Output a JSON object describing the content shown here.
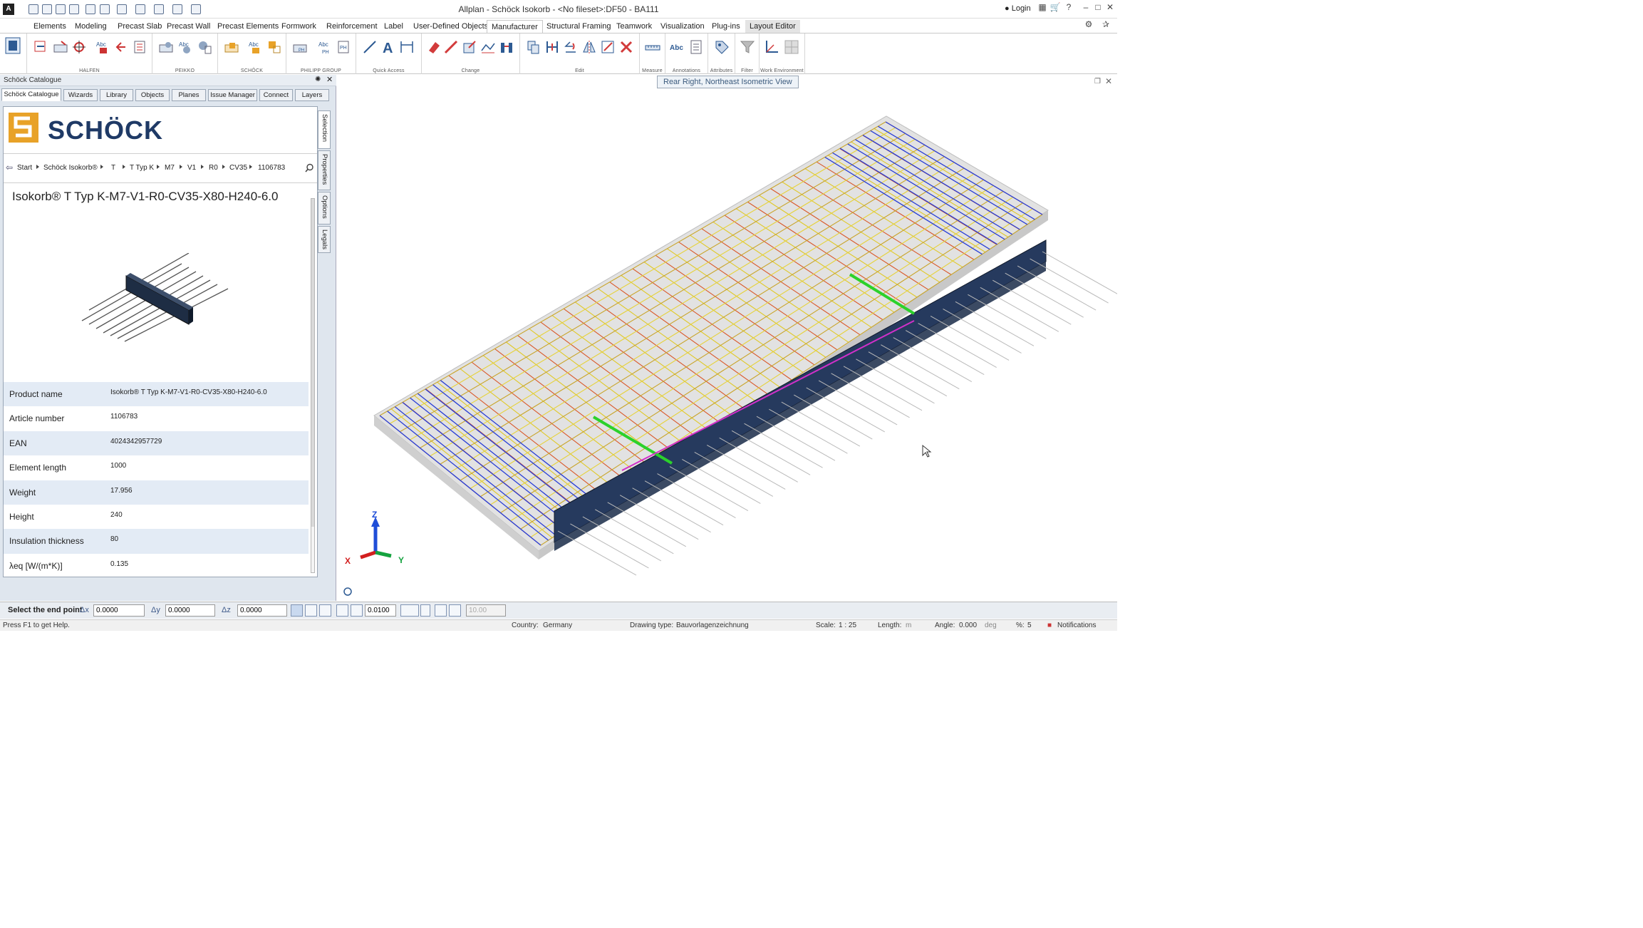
{
  "window": {
    "title": "Allplan - Schöck Isokorb - <No fileset>:DF50 - BA111",
    "login": "Login",
    "logo_letter": "A"
  },
  "ribbon": {
    "tabs": [
      "Elements",
      "Modeling",
      "Precast Slab",
      "Precast Wall",
      "Precast Elements",
      "Formwork",
      "Reinforcement",
      "Label",
      "User-Defined Objects",
      "Manufacturer",
      "Structural Framing",
      "Teamwork",
      "Visualization",
      "Plug-ins",
      "Layout Editor"
    ],
    "active_tab": "Manufacturer",
    "groups": [
      "HALFEN",
      "PEIKKO",
      "SCHÖCK",
      "PHILIPP GROUP",
      "Quick Access",
      "Change",
      "Edit",
      "Measure",
      "Annotations",
      "Attributes",
      "Filter",
      "Work Environment"
    ]
  },
  "panel": {
    "title": "Schöck Catalogue",
    "tabs": [
      "Schöck Catalogue",
      "Wizards",
      "Library",
      "Objects",
      "Planes",
      "Issue Manager",
      "Connect",
      "Layers"
    ],
    "side_tabs": [
      "Selection",
      "Properties",
      "Options",
      "Legals"
    ],
    "brand": "SCHÖCK",
    "breadcrumb": [
      "Start",
      "Schöck Isokorb®",
      "T",
      "T Typ K",
      "M7",
      "V1",
      "R0",
      "CV35",
      "1106783"
    ],
    "product_title": "Isokorb® T Typ K-M7-V1-R0-CV35-X80-H240-6.0",
    "properties": [
      {
        "name": "Product name",
        "value": "Isokorb® T Typ K-M7-V1-R0-CV35-X80-H240-6.0"
      },
      {
        "name": "Article number",
        "value": "1106783"
      },
      {
        "name": "EAN",
        "value": "4024342957729"
      },
      {
        "name": "Element length",
        "value": "1000"
      },
      {
        "name": "Weight",
        "value": "17.956"
      },
      {
        "name": "Height",
        "value": "240"
      },
      {
        "name": "Insulation thickness",
        "value": "80"
      },
      {
        "name": "λeq [W/(m*K)]",
        "value": "0.135"
      }
    ]
  },
  "viewport": {
    "view_label": "Rear Right, Northeast Isometric View",
    "axis_x": "X",
    "axis_y": "Y",
    "axis_z": "Z"
  },
  "command": {
    "prompt": "Select the end point",
    "dx_label": "Δx",
    "dx": "0.0000",
    "dy_label": "Δy",
    "dy": "0.0000",
    "dz_label": "Δz",
    "dz": "0.0000",
    "step": "0.0100",
    "angle_value": "10.00"
  },
  "status": {
    "help": "Press F1 to get Help.",
    "country_label": "Country:",
    "country": "Germany",
    "drawing_type_label": "Drawing type:",
    "drawing_type": "Bauvorlagenzeichnung",
    "scale_label": "Scale:",
    "scale": "1 : 25",
    "length_label": "Length:",
    "length_unit": "m",
    "angle_label": "Angle:",
    "angle": "0.000",
    "angle_unit": "deg",
    "percent_label": "%:",
    "percent": "5",
    "notifications": "Notifications"
  }
}
